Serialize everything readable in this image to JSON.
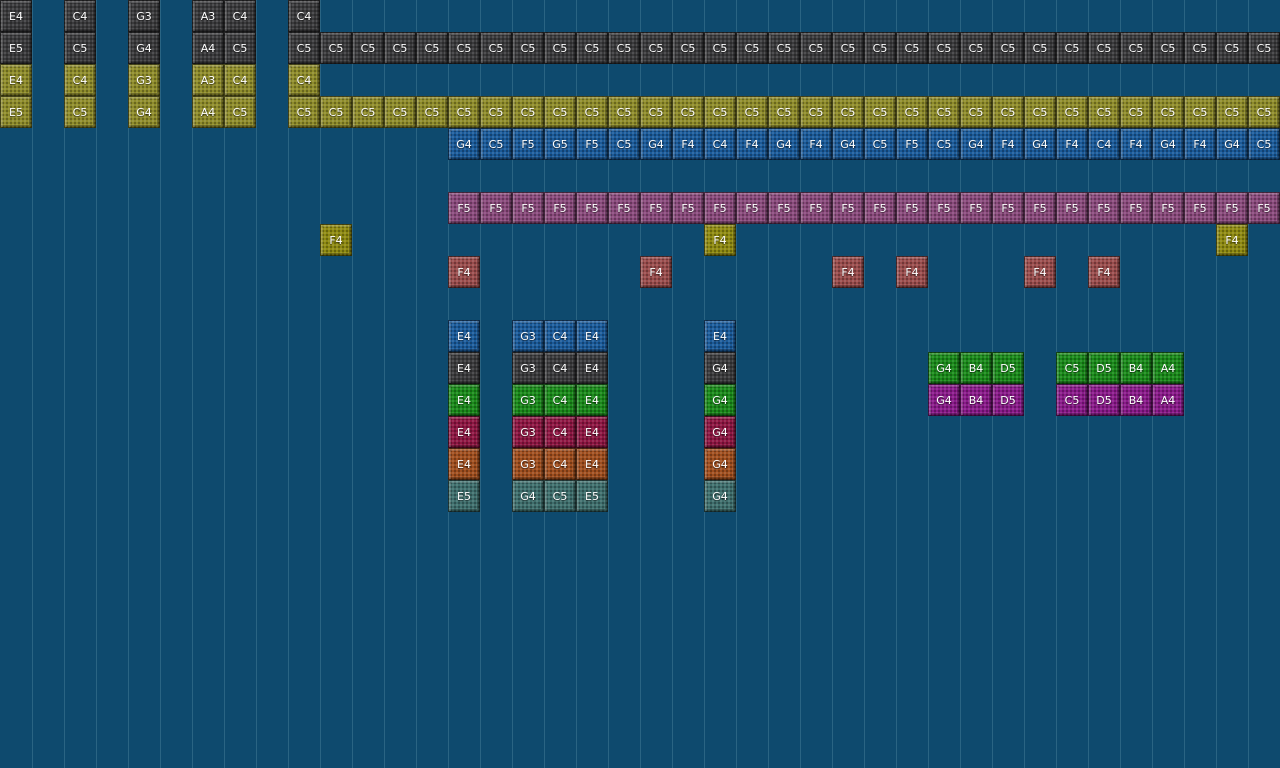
{
  "palette": {
    "grey": "#3a3a3c",
    "olive": "#8f8c2a",
    "blue": "#1a5a9a",
    "pink": "#8a4a7c",
    "yellow": "#8f8a10",
    "red": "#9a4c4c",
    "green": "#1a8a1a",
    "crimson": "#8e1642",
    "orange": "#a04e1e",
    "teal": "#3e6e6c",
    "purple": "#8a1a8a"
  },
  "tracks": [
    {
      "color": "grey",
      "notes": [
        [
          0,
          "E4"
        ],
        [
          2,
          "C4"
        ],
        [
          4,
          "G3"
        ],
        [
          6,
          "A3"
        ],
        [
          7,
          "C4"
        ],
        [
          9,
          "C4"
        ]
      ]
    },
    {
      "color": "grey",
      "notes": [
        [
          0,
          "E5"
        ],
        [
          2,
          "C5"
        ],
        [
          4,
          "G4"
        ],
        [
          6,
          "A4"
        ],
        [
          7,
          "C5"
        ],
        [
          9,
          "C5"
        ],
        [
          10,
          "C5"
        ],
        [
          11,
          "C5"
        ],
        [
          12,
          "C5"
        ],
        [
          13,
          "C5"
        ],
        [
          14,
          "C5"
        ],
        [
          15,
          "C5"
        ],
        [
          16,
          "C5"
        ],
        [
          17,
          "C5"
        ],
        [
          18,
          "C5"
        ],
        [
          19,
          "C5"
        ],
        [
          20,
          "C5"
        ],
        [
          21,
          "C5"
        ],
        [
          22,
          "C5"
        ],
        [
          23,
          "C5"
        ],
        [
          24,
          "C5"
        ],
        [
          25,
          "C5"
        ],
        [
          26,
          "C5"
        ],
        [
          27,
          "C5"
        ],
        [
          28,
          "C5"
        ],
        [
          29,
          "C5"
        ],
        [
          30,
          "C5"
        ],
        [
          31,
          "C5"
        ],
        [
          32,
          "C5"
        ],
        [
          33,
          "C5"
        ],
        [
          34,
          "C5"
        ],
        [
          35,
          "C5"
        ],
        [
          36,
          "C5"
        ],
        [
          37,
          "C5"
        ],
        [
          38,
          "C5"
        ],
        [
          39,
          "C5"
        ]
      ]
    },
    {
      "color": "olive",
      "notes": [
        [
          0,
          "E4"
        ],
        [
          2,
          "C4"
        ],
        [
          4,
          "G3"
        ],
        [
          6,
          "A3"
        ],
        [
          7,
          "C4"
        ],
        [
          9,
          "C4"
        ]
      ]
    },
    {
      "color": "olive",
      "notes": [
        [
          0,
          "E5"
        ],
        [
          2,
          "C5"
        ],
        [
          4,
          "G4"
        ],
        [
          6,
          "A4"
        ],
        [
          7,
          "C5"
        ],
        [
          9,
          "C5"
        ],
        [
          10,
          "C5"
        ],
        [
          11,
          "C5"
        ],
        [
          12,
          "C5"
        ],
        [
          13,
          "C5"
        ],
        [
          14,
          "C5"
        ],
        [
          15,
          "C5"
        ],
        [
          16,
          "C5"
        ],
        [
          17,
          "C5"
        ],
        [
          18,
          "C5"
        ],
        [
          19,
          "C5"
        ],
        [
          20,
          "C5"
        ],
        [
          21,
          "C5"
        ],
        [
          22,
          "C5"
        ],
        [
          23,
          "C5"
        ],
        [
          24,
          "C5"
        ],
        [
          25,
          "C5"
        ],
        [
          26,
          "C5"
        ],
        [
          27,
          "C5"
        ],
        [
          28,
          "C5"
        ],
        [
          29,
          "C5"
        ],
        [
          30,
          "C5"
        ],
        [
          31,
          "C5"
        ],
        [
          32,
          "C5"
        ],
        [
          33,
          "C5"
        ],
        [
          34,
          "C5"
        ],
        [
          35,
          "C5"
        ],
        [
          36,
          "C5"
        ],
        [
          37,
          "C5"
        ],
        [
          38,
          "C5"
        ],
        [
          39,
          "C5"
        ]
      ]
    },
    {
      "color": "blue",
      "notes": [
        [
          14,
          "G4"
        ],
        [
          15,
          "C5"
        ],
        [
          16,
          "F5"
        ],
        [
          17,
          "G5"
        ],
        [
          18,
          "F5"
        ],
        [
          19,
          "C5"
        ],
        [
          20,
          "G4"
        ],
        [
          21,
          "F4"
        ],
        [
          22,
          "C4"
        ],
        [
          23,
          "F4"
        ],
        [
          24,
          "G4"
        ],
        [
          25,
          "F4"
        ],
        [
          26,
          "G4"
        ],
        [
          27,
          "C5"
        ],
        [
          28,
          "F5"
        ],
        [
          29,
          "C5"
        ],
        [
          30,
          "G4"
        ],
        [
          31,
          "F4"
        ],
        [
          32,
          "G4"
        ],
        [
          33,
          "F4"
        ],
        [
          34,
          "C4"
        ],
        [
          35,
          "F4"
        ],
        [
          36,
          "G4"
        ],
        [
          37,
          "F4"
        ],
        [
          38,
          "G4"
        ],
        [
          39,
          "C5"
        ]
      ]
    },
    {
      "color": "pink",
      "notes": []
    },
    {
      "color": "pink",
      "notes": [
        [
          14,
          "F5"
        ],
        [
          15,
          "F5"
        ],
        [
          16,
          "F5"
        ],
        [
          17,
          "F5"
        ],
        [
          18,
          "F5"
        ],
        [
          19,
          "F5"
        ],
        [
          20,
          "F5"
        ],
        [
          21,
          "F5"
        ],
        [
          22,
          "F5"
        ],
        [
          23,
          "F5"
        ],
        [
          24,
          "F5"
        ],
        [
          25,
          "F5"
        ],
        [
          26,
          "F5"
        ],
        [
          27,
          "F5"
        ],
        [
          28,
          "F5"
        ],
        [
          29,
          "F5"
        ],
        [
          30,
          "F5"
        ],
        [
          31,
          "F5"
        ],
        [
          32,
          "F5"
        ],
        [
          33,
          "F5"
        ],
        [
          34,
          "F5"
        ],
        [
          35,
          "F5"
        ],
        [
          36,
          "F5"
        ],
        [
          37,
          "F5"
        ],
        [
          38,
          "F5"
        ],
        [
          39,
          "F5"
        ]
      ]
    },
    {
      "color": "yellow",
      "notes": [
        [
          10,
          "F4"
        ],
        [
          22,
          "F4"
        ],
        [
          38,
          "F4"
        ]
      ]
    },
    {
      "color": "red",
      "notes": [
        [
          14,
          "F4"
        ],
        [
          20,
          "F4"
        ],
        [
          26,
          "F4"
        ],
        [
          28,
          "F4"
        ],
        [
          32,
          "F4"
        ],
        [
          34,
          "F4"
        ]
      ]
    },
    {
      "color": "red",
      "notes": []
    },
    {
      "color": "blue",
      "notes": [
        [
          14,
          "E4"
        ],
        [
          16,
          "G3"
        ],
        [
          17,
          "C4"
        ],
        [
          18,
          "E4"
        ],
        [
          22,
          "E4"
        ]
      ]
    },
    {
      "color": "grey",
      "notes": [
        [
          14,
          "E4"
        ],
        [
          16,
          "G3"
        ],
        [
          17,
          "C4"
        ],
        [
          18,
          "E4"
        ],
        [
          22,
          "G4"
        ]
      ]
    },
    {
      "color": "green",
      "notes": [
        [
          14,
          "E4"
        ],
        [
          16,
          "G3"
        ],
        [
          17,
          "C4"
        ],
        [
          18,
          "E4"
        ],
        [
          22,
          "G4"
        ]
      ]
    },
    {
      "color": "crimson",
      "notes": [
        [
          14,
          "E4"
        ],
        [
          16,
          "G3"
        ],
        [
          17,
          "C4"
        ],
        [
          18,
          "E4"
        ],
        [
          22,
          "G4"
        ]
      ]
    },
    {
      "color": "orange",
      "notes": [
        [
          14,
          "E4"
        ],
        [
          16,
          "G3"
        ],
        [
          17,
          "C4"
        ],
        [
          18,
          "E4"
        ],
        [
          22,
          "G4"
        ]
      ]
    },
    {
      "color": "teal",
      "notes": [
        [
          14,
          "E5"
        ],
        [
          16,
          "G4"
        ],
        [
          17,
          "C5"
        ],
        [
          18,
          "E5"
        ],
        [
          22,
          "G4"
        ]
      ]
    }
  ],
  "extra_tracks": [
    {
      "row": 11,
      "color": "green",
      "notes": [
        [
          29,
          "G4"
        ],
        [
          30,
          "B4"
        ],
        [
          31,
          "D5"
        ],
        [
          33,
          "C5"
        ],
        [
          34,
          "D5"
        ],
        [
          35,
          "B4"
        ],
        [
          36,
          "A4"
        ]
      ]
    },
    {
      "row": 12,
      "color": "purple",
      "notes": [
        [
          29,
          "G4"
        ],
        [
          30,
          "B4"
        ],
        [
          31,
          "D5"
        ],
        [
          33,
          "C5"
        ],
        [
          34,
          "D5"
        ],
        [
          35,
          "B4"
        ],
        [
          36,
          "A4"
        ]
      ]
    }
  ]
}
